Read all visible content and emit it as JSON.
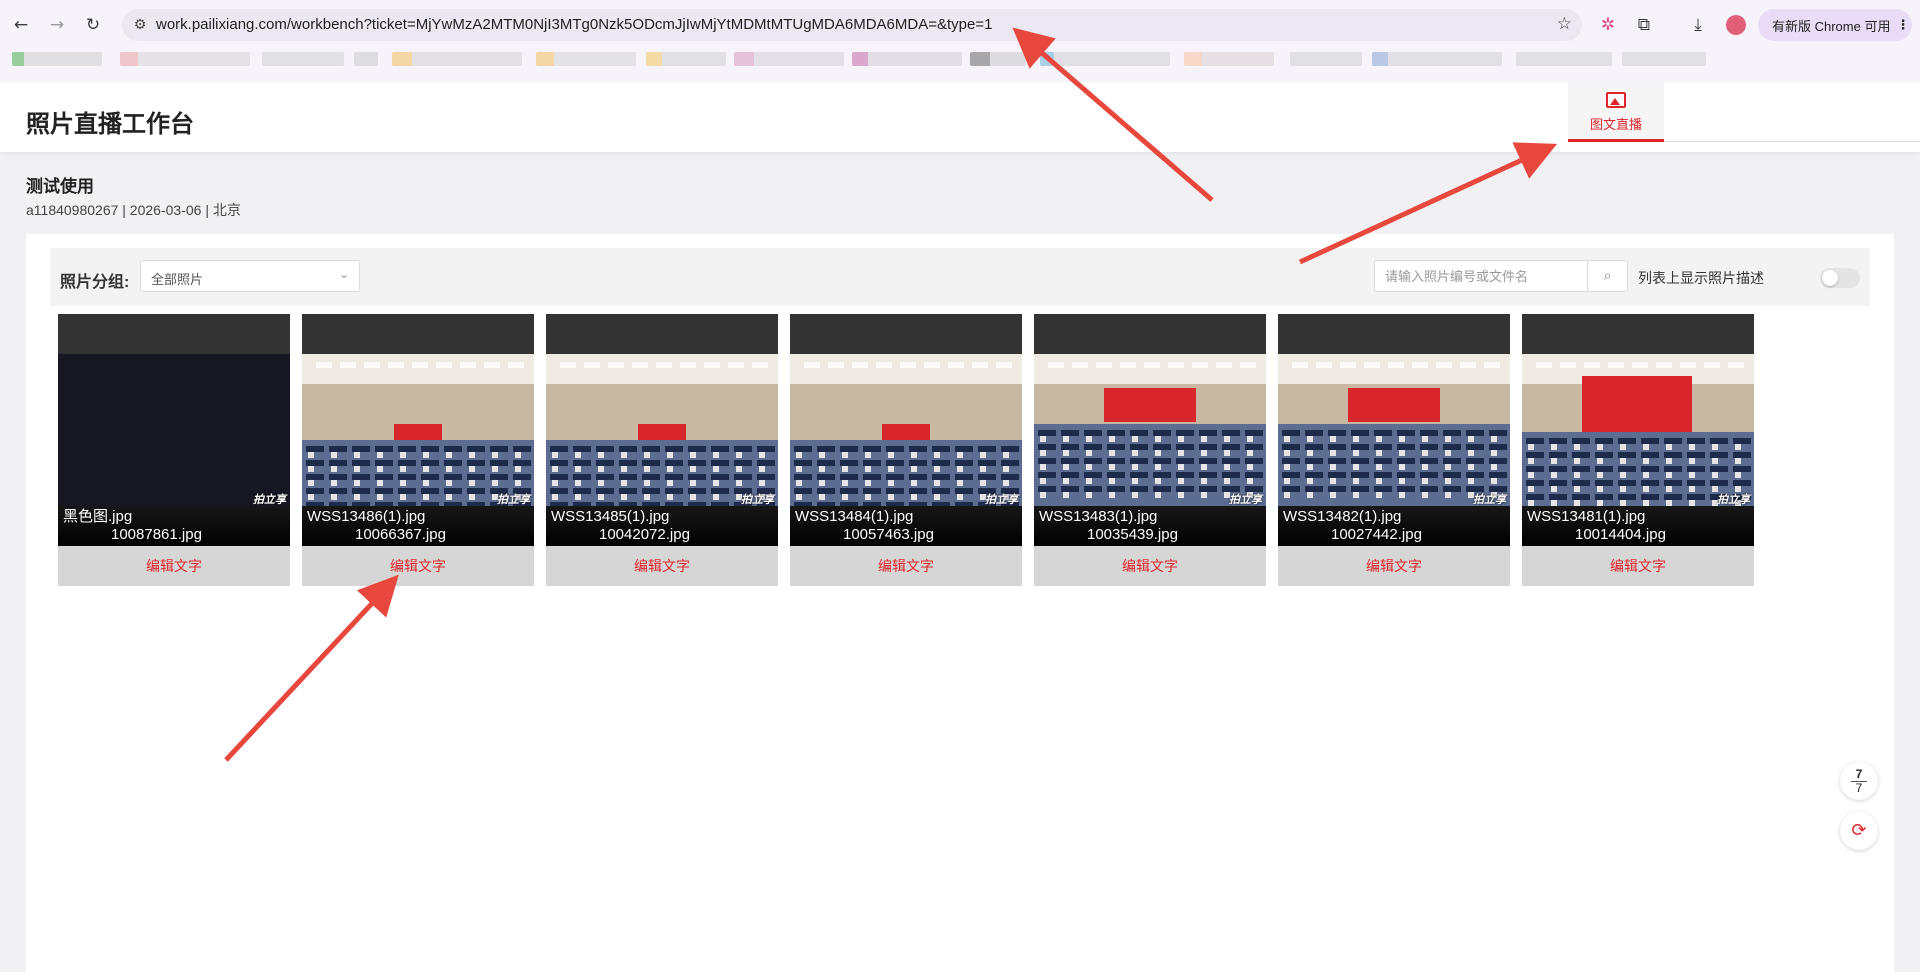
{
  "browser": {
    "url": "work.pailixiang.com/workbench?ticket=MjYwMzA2MTM0NjI3MTg0Nzk5ODcmJjIwMjYtMDMtMTUgMDA6MDA6MDA=&type=1",
    "update_button": "有新版 Chrome 可用",
    "icons": {
      "back": "back-arrow-icon",
      "forward": "forward-arrow-icon",
      "reload": "reload-icon",
      "site_info": "site-info-icon",
      "bookmark": "bookmark-star-icon",
      "extension": "extension-icon",
      "puzzle": "puzzle-icon",
      "download": "download-icon",
      "menu": "menu-dots-icon"
    }
  },
  "app": {
    "title": "照片直播工作台",
    "tab_label": "图文直播"
  },
  "event": {
    "name": "测试使用",
    "meta": "a11840980267 | 2026-03-06 | 北京"
  },
  "filter": {
    "group_label": "照片分组:",
    "group_value": "全部照片",
    "search_placeholder": "请输入照片编号或文件名",
    "desc_toggle_label": "列表上显示照片描述",
    "desc_toggle_on": false
  },
  "photos": [
    {
      "filename": "黑色图.jpg",
      "id": "10087861.jpg",
      "edit_label": "编辑文字",
      "kind": "black"
    },
    {
      "filename": "WSS13486(1).jpg",
      "id": "10066367.jpg",
      "edit_label": "编辑文字",
      "kind": "hall"
    },
    {
      "filename": "WSS13485(1).jpg",
      "id": "10042072.jpg",
      "edit_label": "编辑文字",
      "kind": "hall"
    },
    {
      "filename": "WSS13484(1).jpg",
      "id": "10057463.jpg",
      "edit_label": "编辑文字",
      "kind": "hall"
    },
    {
      "filename": "WSS13483(1).jpg",
      "id": "10035439.jpg",
      "edit_label": "编辑文字",
      "kind": "hall-close"
    },
    {
      "filename": "WSS13482(1).jpg",
      "id": "10027442.jpg",
      "edit_label": "编辑文字",
      "kind": "hall-close"
    },
    {
      "filename": "WSS13481(1).jpg",
      "id": "10014404.jpg",
      "edit_label": "编辑文字",
      "kind": "hall-stage"
    }
  ],
  "watermark": "拍立享",
  "pager": {
    "current": "7",
    "total": "7"
  },
  "colors": {
    "accent": "#e0252a",
    "card_bg": "#d6d6d6",
    "arrow": "#e8473d"
  }
}
